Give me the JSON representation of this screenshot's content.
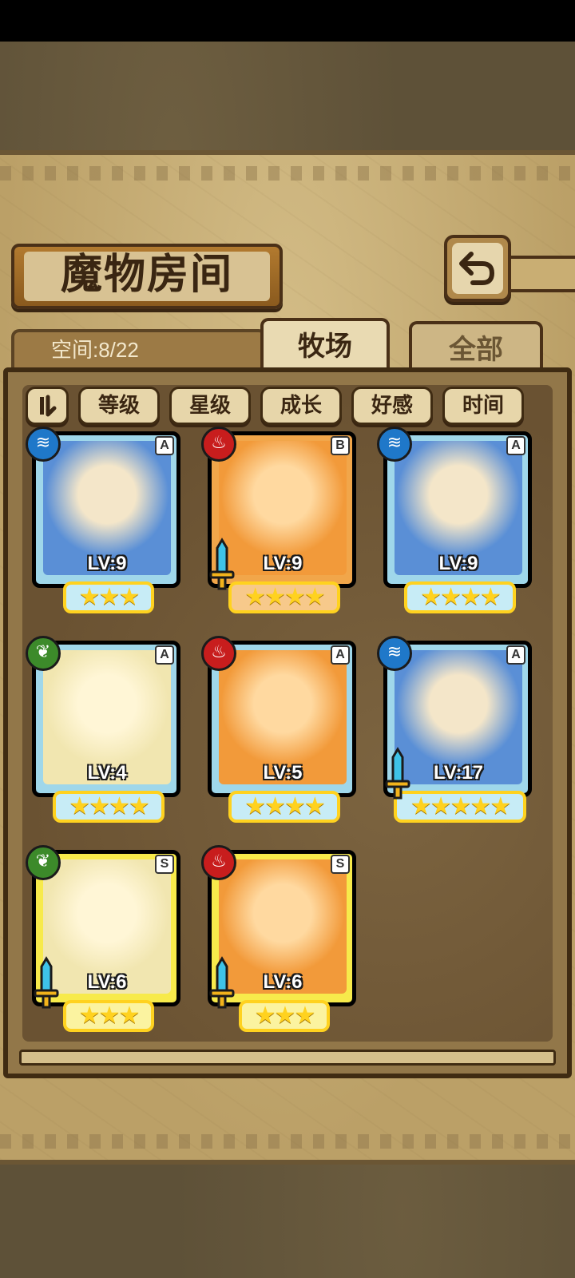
{
  "header": {
    "title": "魔物房间",
    "back_icon": "return-arrow-icon"
  },
  "space": {
    "label": "空间:8/22"
  },
  "tabs": [
    {
      "label": "牧场",
      "active": true
    },
    {
      "label": "全部",
      "active": false
    }
  ],
  "sort": {
    "toggle_icon": "sort-toggle-icon",
    "buttons": [
      "等级",
      "星级",
      "成长",
      "好感",
      "时间"
    ]
  },
  "monsters": [
    {
      "element": "water",
      "rank": "A",
      "level": "LV:9",
      "stars": "★★★",
      "star_count": 3,
      "has_sword": false
    },
    {
      "element": "fire",
      "rank": "B",
      "level": "LV:9",
      "stars": "★★★★",
      "star_count": 4,
      "has_sword": true
    },
    {
      "element": "water",
      "rank": "A",
      "level": "LV:9",
      "stars": "★★★★",
      "star_count": 4,
      "has_sword": false
    },
    {
      "element": "leaf",
      "rank": "A",
      "level": "LV:4",
      "stars": "★★★★",
      "star_count": 4,
      "has_sword": false
    },
    {
      "element": "fire",
      "rank": "A",
      "level": "LV:5",
      "stars": "★★★★",
      "star_count": 4,
      "has_sword": false
    },
    {
      "element": "water",
      "rank": "A",
      "level": "LV:17",
      "stars": "★★★★★",
      "star_count": 5,
      "has_sword": true
    },
    {
      "element": "leaf",
      "rank": "S",
      "level": "LV:6",
      "stars": "★★★",
      "star_count": 3,
      "has_sword": true
    },
    {
      "element": "fire",
      "rank": "S",
      "level": "LV:6",
      "stars": "★★★",
      "star_count": 3,
      "has_sword": true
    }
  ],
  "colors": {
    "water": "#1f78c9",
    "fire": "#c81d1d",
    "leaf": "#3c8a2a",
    "frame_A": "#9fd7ea",
    "frame_B": "#f1a64a",
    "frame_S": "#f7ea4b",
    "star": "#ffd21f"
  }
}
